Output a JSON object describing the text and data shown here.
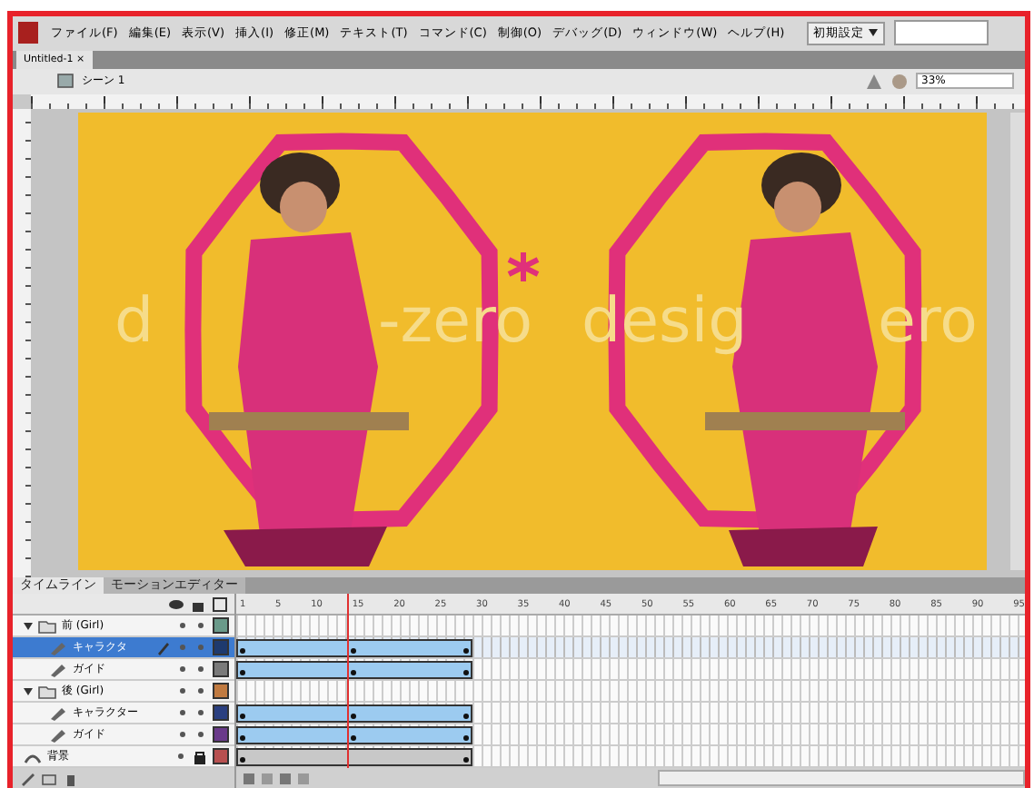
{
  "menu": [
    {
      "label": "ファイル(F)"
    },
    {
      "label": "編集(E)"
    },
    {
      "label": "表示(V)"
    },
    {
      "label": "挿入(I)"
    },
    {
      "label": "修正(M)"
    },
    {
      "label": "テキスト(T)"
    },
    {
      "label": "コマンド(C)"
    },
    {
      "label": "制御(O)"
    },
    {
      "label": "デバッグ(D)"
    },
    {
      "label": "ウィンドウ(W)"
    },
    {
      "label": "ヘルプ(H)"
    }
  ],
  "workspace": {
    "label": "初期設定"
  },
  "document_tab": {
    "label": "Untitled-1",
    "close": "×"
  },
  "scene": {
    "label": "シーン 1"
  },
  "zoom": {
    "value": "33%"
  },
  "stage": {
    "left_texts": [
      "d",
      "-zero"
    ],
    "right_texts": [
      "desig",
      "ero"
    ]
  },
  "timeline": {
    "tabs": [
      {
        "label": "タイムライン",
        "selected": true
      },
      {
        "label": "モーションエディター",
        "selected": false
      }
    ],
    "frame_numbers": [
      "1",
      "5",
      "10",
      "15",
      "20",
      "25",
      "30",
      "35",
      "40",
      "45",
      "50",
      "55",
      "60",
      "65",
      "70",
      "75",
      "80",
      "85",
      "90",
      "95"
    ],
    "playhead": {
      "level": 0.14
    },
    "layers": [
      {
        "name": "前 (Girl)",
        "kind": "folder",
        "expanded": true,
        "selected": false,
        "locked": false,
        "color": "#6a9a8a",
        "children": [
          {
            "name": "キャラクタ",
            "kind": "layer",
            "selected": true,
            "locked": false,
            "color": "#1e3a6e",
            "tween": true
          },
          {
            "name": "ガイド",
            "kind": "layer",
            "selected": false,
            "locked": false,
            "color": "#7a7a7a",
            "tween": true
          }
        ]
      },
      {
        "name": "後 (Girl)",
        "kind": "folder",
        "expanded": true,
        "selected": false,
        "locked": false,
        "color": "#c07a40",
        "children": [
          {
            "name": "キャラクター",
            "kind": "layer",
            "selected": false,
            "locked": false,
            "color": "#2a3f80",
            "tween": true
          },
          {
            "name": "ガイド",
            "kind": "layer",
            "selected": false,
            "locked": false,
            "color": "#6a3a8a",
            "tween": true
          }
        ]
      },
      {
        "name": "背景",
        "kind": "guide",
        "selected": false,
        "locked": true,
        "color": "#b85050",
        "tween": false
      }
    ]
  }
}
